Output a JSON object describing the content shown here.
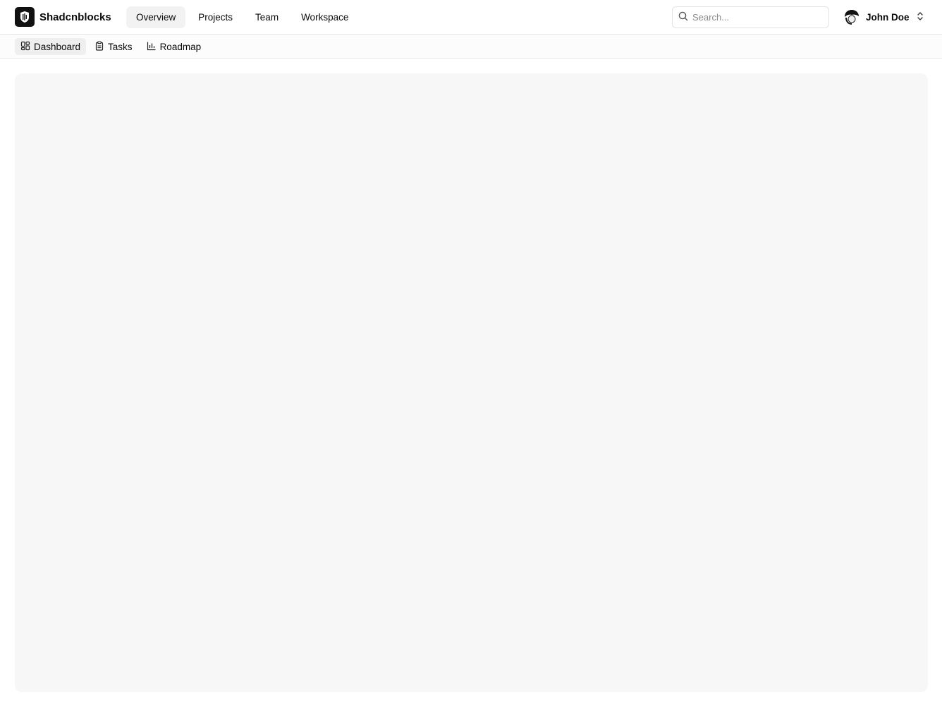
{
  "brand": {
    "name": "Shadcnblocks",
    "logo_icon": "shadcnblocks-logo-icon"
  },
  "main_nav": {
    "items": [
      {
        "label": "Overview",
        "active": true
      },
      {
        "label": "Projects",
        "active": false
      },
      {
        "label": "Team",
        "active": false
      },
      {
        "label": "Workspace",
        "active": false
      }
    ]
  },
  "search": {
    "placeholder": "Search...",
    "value": "",
    "icon": "search-icon"
  },
  "user": {
    "name": "John Doe",
    "avatar_icon": "avatar",
    "menu_icon": "chevrons-up-down-icon"
  },
  "sub_nav": {
    "items": [
      {
        "label": "Dashboard",
        "icon": "layout-grid-icon",
        "active": true
      },
      {
        "label": "Tasks",
        "icon": "clipboard-icon",
        "active": false
      },
      {
        "label": "Roadmap",
        "icon": "bar-chart-icon",
        "active": false
      }
    ]
  },
  "colors": {
    "active_nav_bg": "#f2f2f2",
    "content_panel_bg": "#f7f7f7",
    "border": "#e5e5e5",
    "text": "#0a0a0a"
  }
}
